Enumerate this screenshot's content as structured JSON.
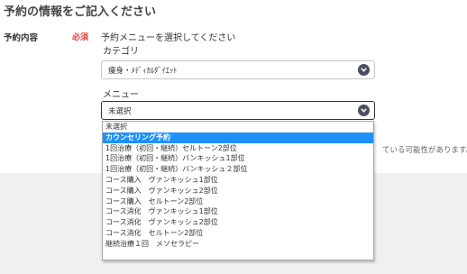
{
  "section_title": "予約の情報をご記入ください",
  "field": {
    "label": "予約内容",
    "required": "必須",
    "instruction": "予約メニューを選択してください"
  },
  "category": {
    "label": "カテゴリ",
    "selected": "痩身・ﾒﾃﾞｨｶﾙﾀﾞｲｴｯﾄ"
  },
  "menu": {
    "label": "メニュー",
    "selected": "未選択",
    "options": [
      "未選択",
      "カウンセリング予約",
      "1回治療（初回・継続）セルトーン2部位",
      "1回治療（初回・継続）バンキッシュ1部位",
      "1回治療（初回・継続）バンキッシュ２部位",
      "コース購入　ヴァンキッシュ1部位",
      "コース購入　ヴァンキッシュ2部位",
      "コース購入　セルトーン2部位",
      "コース消化　ヴァンキッシュ1部位",
      "コース消化　ヴァンキッシュ2部位",
      "コース消化　セルトーン2部位",
      "継続治療１回　メソセラピー"
    ],
    "highlighted_option": "カウンセリング予約"
  },
  "hint_text": "ている可能性があります。",
  "colors": {
    "required": "#e8383d",
    "highlight": "#1e90ff",
    "arrow_badge": "#4a5060",
    "bottom_band": "#f0f0f0"
  },
  "icons": {
    "category_arrow": "chevron-down-icon",
    "menu_arrow": "chevron-down-icon"
  }
}
